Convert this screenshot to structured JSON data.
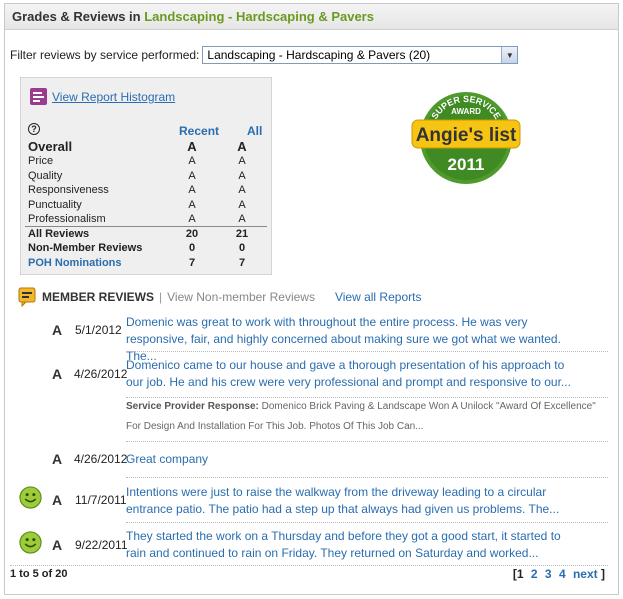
{
  "header": {
    "title_prefix": "Grades & Reviews in ",
    "title_category": "Landscaping - Hardscaping & Pavers"
  },
  "filter": {
    "label": "Filter reviews by service performed:",
    "selected": "Landscaping - Hardscaping & Pavers (20)"
  },
  "grades": {
    "histogram_link": "View Report Histogram",
    "help_icon": "question-icon",
    "col_recent": "Recent",
    "col_all": "All",
    "rows": [
      {
        "label": "Overall",
        "recent": "A",
        "all": "A"
      },
      {
        "label": "Price",
        "recent": "A",
        "all": "A"
      },
      {
        "label": "Quality",
        "recent": "A",
        "all": "A"
      },
      {
        "label": "Responsiveness",
        "recent": "A",
        "all": "A"
      },
      {
        "label": "Punctuality",
        "recent": "A",
        "all": "A"
      },
      {
        "label": "Professionalism",
        "recent": "A",
        "all": "A"
      }
    ],
    "totals": [
      {
        "label": "All Reviews",
        "recent": "20",
        "all": "21"
      },
      {
        "label": "Non-Member Reviews",
        "recent": "0",
        "all": "0"
      },
      {
        "label": "POH Nominations",
        "recent": "7",
        "all": "7"
      }
    ]
  },
  "badge": {
    "top_text": "SUPER SERVICE",
    "mid_text": "AWARD",
    "brand": "Angie's list",
    "year": "2011"
  },
  "reviews_header": {
    "member": "MEMBER REVIEWS",
    "separator": "|",
    "non_member": "View Non-member Reviews",
    "view_all": "View all Reports"
  },
  "reviews": [
    {
      "grade": "A",
      "date": "5/1/2012",
      "text": "Domenic was great to work with throughout the entire process. He was very responsive, fair, and highly concerned about making sure we got what we wanted. The...",
      "smiley": false
    },
    {
      "grade": "A",
      "date": "4/26/2012",
      "text": "Domenico came to our house and gave a thorough presentation of his approach to our job. He and his crew were very professional and prompt and responsive to our...",
      "smiley": false
    },
    {
      "grade": "A",
      "date": "4/26/2012",
      "text": "Great company",
      "smiley": false
    },
    {
      "grade": "A",
      "date": "11/7/2011",
      "text": "Intentions were just to raise the walkway from the driveway leading to a circular entrance patio. The patio had a step up that always had given us problems. The...",
      "smiley": true
    },
    {
      "grade": "A",
      "date": "9/22/2011",
      "text": "They started the work on a Thursday and before they got a good start, it started to rain and continued to rain on Friday.  They returned on Saturday and worked...",
      "smiley": true
    }
  ],
  "sp_response": {
    "label": "Service Provider Response:",
    "text": " Domenico Brick Paving & Landscape Won A Unilock \"Award Of Excellence\" For Design And Installation For This Job. Photos Of This Job Can..."
  },
  "footer": {
    "range": "1 to 5 of 20"
  },
  "pager": {
    "open": "[",
    "pages": [
      "1",
      "2",
      "3",
      "4"
    ],
    "next": "next",
    "close": "]"
  },
  "colors": {
    "link": "#2a6db0",
    "green": "#6a9a1f",
    "badge_yellow": "#f6c412",
    "badge_green": "#4f9a2c"
  }
}
